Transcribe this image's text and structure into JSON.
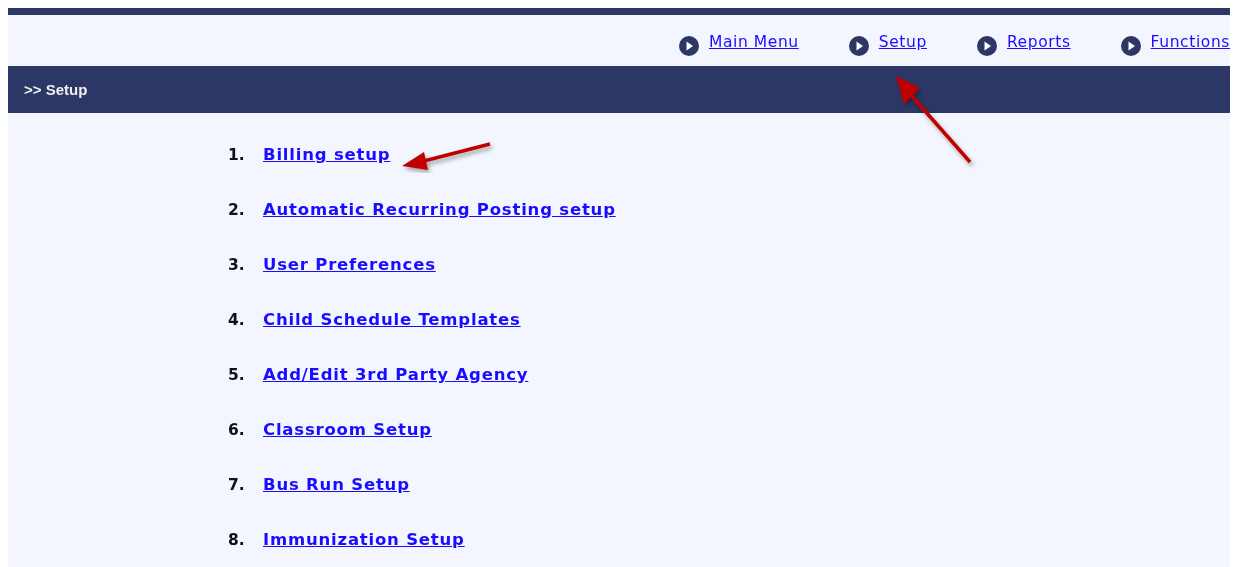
{
  "nav": [
    {
      "label": "Main Menu"
    },
    {
      "label": "Setup"
    },
    {
      "label": "Reports"
    },
    {
      "label": "Functions"
    }
  ],
  "breadcrumb": ">> Setup",
  "items": [
    {
      "number": "1.",
      "label": "Billing setup"
    },
    {
      "number": "2.",
      "label": "Automatic Recurring Posting setup"
    },
    {
      "number": "3.",
      "label": "User Preferences"
    },
    {
      "number": "4.",
      "label": "Child Schedule Templates"
    },
    {
      "number": "5.",
      "label": "Add/Edit 3rd Party Agency"
    },
    {
      "number": "6.",
      "label": "Classroom Setup"
    },
    {
      "number": "7.",
      "label": "Bus Run Setup"
    },
    {
      "number": "8.",
      "label": "Immunization Setup"
    }
  ]
}
